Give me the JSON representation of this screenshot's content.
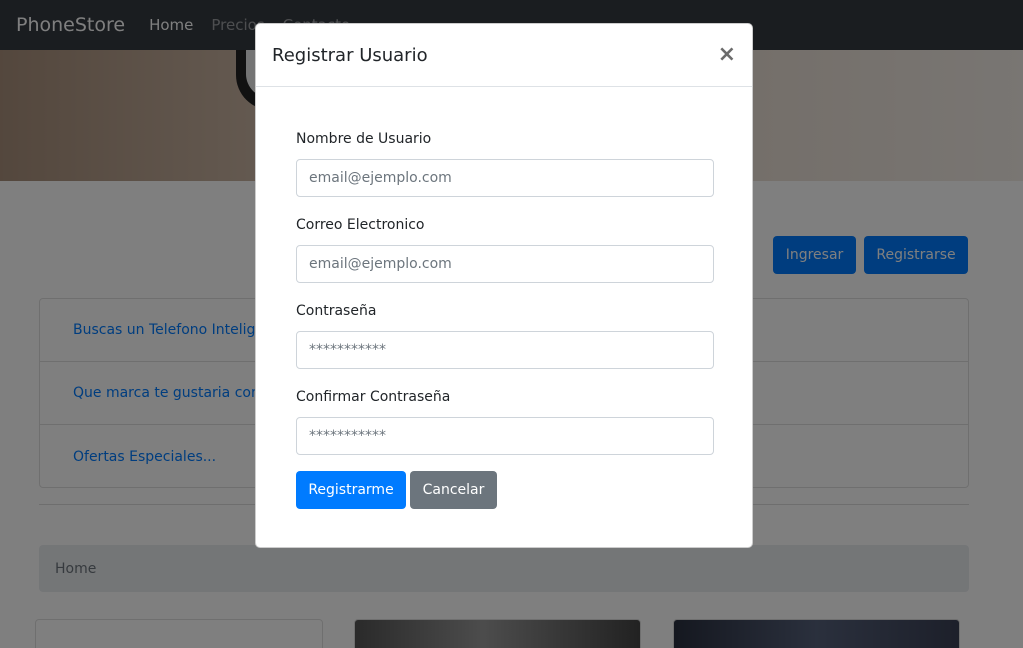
{
  "navbar": {
    "brand": "PhoneStore",
    "links": [
      "Home",
      "Precios",
      "Contacto"
    ]
  },
  "auth": {
    "login_label": "Ingresar",
    "register_label": "Registrarse"
  },
  "list": {
    "items": [
      "Buscas un Telefono Inteligente?",
      "Que marca te gustaria comprar?",
      "Ofertas Especiales..."
    ]
  },
  "breadcrumb": {
    "current": "Home"
  },
  "modal": {
    "title": "Registrar Usuario",
    "close_glyph": "×",
    "fields": {
      "username": {
        "label": "Nombre de Usuario",
        "placeholder": "email@ejemplo.com",
        "type": "text"
      },
      "email": {
        "label": "Correo Electronico",
        "placeholder": "email@ejemplo.com",
        "type": "email"
      },
      "password": {
        "label": "Contraseña",
        "placeholder": "***********",
        "type": "text"
      },
      "confirm": {
        "label": "Confirmar Contraseña",
        "placeholder": "***********",
        "type": "text"
      }
    },
    "submit_label": "Registrarme",
    "cancel_label": "Cancelar"
  },
  "colors": {
    "navbar_bg": "#343a40",
    "primary": "#007bff",
    "secondary": "#6c757d",
    "breadcrumb_bg": "#e9ecef"
  }
}
